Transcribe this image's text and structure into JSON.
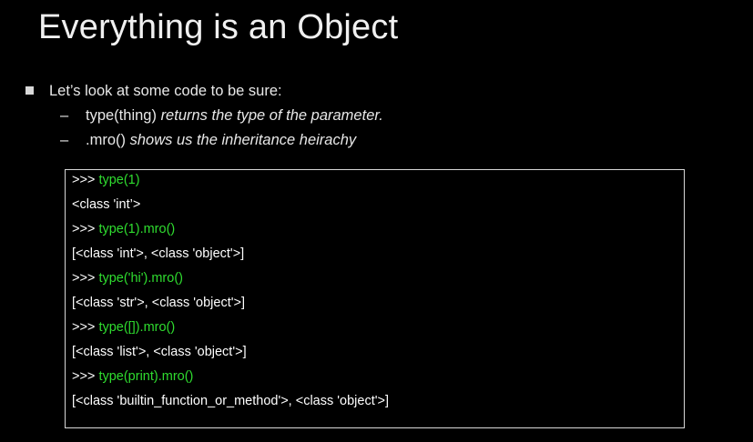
{
  "slide": {
    "title": "Everything is an Object",
    "bullet": "Let’s look at some code to be sure:",
    "subbullets": [
      {
        "dash": "–",
        "code": "type(thing)",
        "desc": "returns the type of the parameter."
      },
      {
        "dash": "–",
        "code": ".mro()",
        "desc": "shows us the inheritance heirachy"
      }
    ]
  },
  "code": {
    "prompt": ">>>",
    "lines": [
      {
        "kind": "input",
        "text": "type(1)"
      },
      {
        "kind": "output",
        "text": "<class 'int’>"
      },
      {
        "kind": "input",
        "text": "type(1).mro()"
      },
      {
        "kind": "output",
        "text": "[<class 'int'>, <class 'object'>]"
      },
      {
        "kind": "input",
        "text": "type('hi').mro()"
      },
      {
        "kind": "output",
        "text": "[<class 'str'>, <class 'object'>]"
      },
      {
        "kind": "input",
        "text": "type([]).mro()"
      },
      {
        "kind": "output",
        "text": "[<class 'list'>, <class 'object'>]"
      },
      {
        "kind": "input",
        "text": "type(print).mro()"
      },
      {
        "kind": "output",
        "text": "[<class 'builtin_function_or_method'>, <class 'object'>]"
      }
    ]
  },
  "colors": {
    "background": "#000000",
    "text": "#e8e8e8",
    "code_input": "#2fdc2f",
    "box_border": "#d8d8d8"
  }
}
